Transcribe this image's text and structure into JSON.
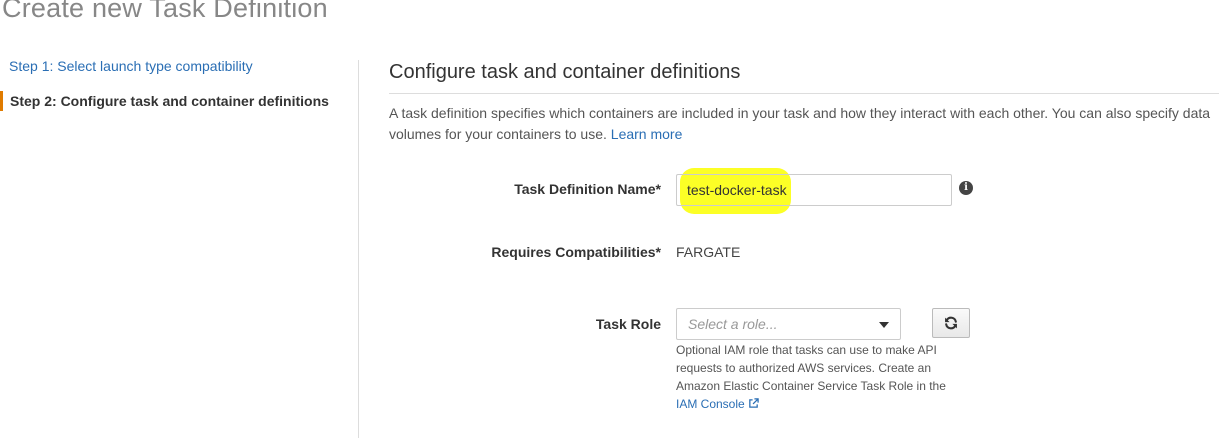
{
  "page": {
    "title": "Create new Task Definition"
  },
  "steps": {
    "step1": "Step 1: Select launch type compatibility",
    "step2": "Step 2: Configure task and container definitions"
  },
  "section": {
    "title": "Configure task and container definitions",
    "description": "A task definition specifies which containers are included in your task and how they interact with each other. You can also specify data volumes for your containers to use.",
    "learn_more": "Learn more"
  },
  "form": {
    "task_definition_name": {
      "label": "Task Definition Name*",
      "value": "test-docker-task",
      "info_icon": "info-circle-icon"
    },
    "requires_compatibilities": {
      "label": "Requires Compatibilities*",
      "value": "FARGATE"
    },
    "task_role": {
      "label": "Task Role",
      "placeholder": "Select a role...",
      "refresh_icon": "refresh-icon",
      "help_text": "Optional IAM role that tasks can use to make API requests to authorized AWS services. Create an Amazon Elastic Container Service Task Role in the",
      "iam_console_link": "IAM Console",
      "external_link_icon": "external-link-icon"
    }
  },
  "colors": {
    "link": "#2a6eb4",
    "active_step_marker": "#e07b00",
    "highlight": "#fbff00",
    "title_gray": "#878787"
  }
}
